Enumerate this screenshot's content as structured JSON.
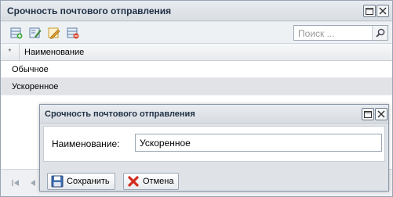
{
  "window": {
    "title": "Срочность почтового отправления"
  },
  "toolbar": {
    "icons": [
      "add-icon",
      "edit-icon",
      "edit-pencil-icon",
      "delete-icon"
    ],
    "search_placeholder": "Поиск ..."
  },
  "grid": {
    "marker": "*",
    "column_header": "Наименование",
    "rows": [
      {
        "name": "Обычное",
        "selected": false
      },
      {
        "name": "Ускоренное",
        "selected": true
      }
    ]
  },
  "dialog": {
    "title": "Срочность почтового отправления",
    "field_label": "Наименование:",
    "field_value": "Ускоренное",
    "save_label": "Сохранить",
    "cancel_label": "Отмена"
  }
}
